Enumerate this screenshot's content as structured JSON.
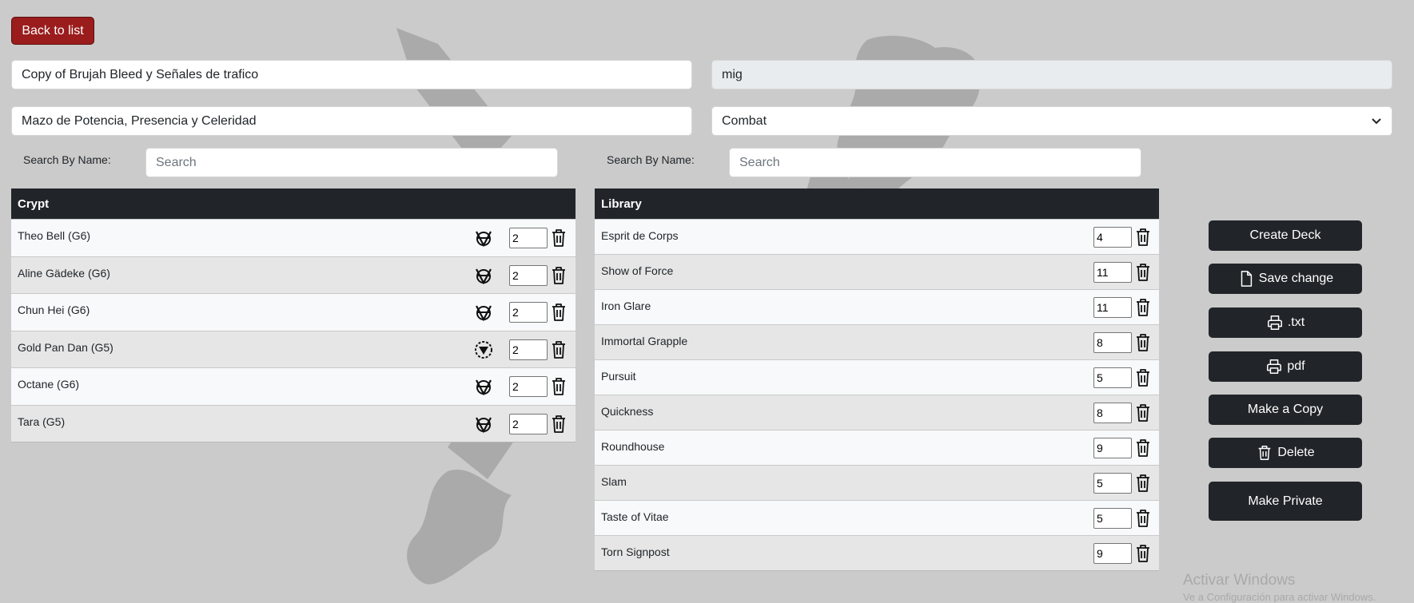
{
  "back_button": "Back to list",
  "deck": {
    "name": "Copy of Brujah Bleed y Señales de trafico",
    "author": "mig",
    "description": "Mazo de Potencia, Presencia y Celeridad",
    "type_select": "Combat"
  },
  "search": {
    "crypt_label": "Search By Name:",
    "crypt_placeholder": "Search",
    "library_label": "Search By Name:",
    "library_placeholder": "Search"
  },
  "crypt": {
    "header": "Crypt",
    "rows": [
      {
        "name": "Theo Bell (G6)",
        "clan_icon": "brujah-antitribu-icon",
        "qty": "2"
      },
      {
        "name": "Aline Gädeke (G6)",
        "clan_icon": "brujah-antitribu-icon",
        "qty": "2"
      },
      {
        "name": "Chun Hei (G6)",
        "clan_icon": "brujah-antitribu-icon",
        "qty": "2"
      },
      {
        "name": "Gold Pan Dan (G5)",
        "clan_icon": "brujah-clan-icon",
        "qty": "2"
      },
      {
        "name": "Octane (G6)",
        "clan_icon": "brujah-antitribu-icon",
        "qty": "2"
      },
      {
        "name": "Tara (G5)",
        "clan_icon": "brujah-antitribu-icon",
        "qty": "2"
      }
    ]
  },
  "library": {
    "header": "Library",
    "rows": [
      {
        "name": "Esprit de Corps",
        "qty": "4"
      },
      {
        "name": "Show of Force",
        "qty": "11"
      },
      {
        "name": "Iron Glare",
        "qty": "11"
      },
      {
        "name": "Immortal Grapple",
        "qty": "8"
      },
      {
        "name": "Pursuit",
        "qty": "5"
      },
      {
        "name": "Quickness",
        "qty": "8"
      },
      {
        "name": "Roundhouse",
        "qty": "9"
      },
      {
        "name": "Slam",
        "qty": "5"
      },
      {
        "name": "Taste of Vitae",
        "qty": "5"
      },
      {
        "name": "Torn Signpost",
        "qty": "9"
      }
    ]
  },
  "actions": {
    "create": "Create Deck",
    "save": "Save change",
    "txt": ".txt",
    "pdf": "pdf",
    "copy": "Make a Copy",
    "delete": "Delete",
    "private": "Make Private"
  },
  "watermark": {
    "title": "Activar Windows",
    "subtitle": "Ve a Configuración para activar Windows."
  },
  "colors": {
    "background": "#cbcbcb",
    "back_button": "#9b1c1c",
    "dark": "#212529"
  }
}
